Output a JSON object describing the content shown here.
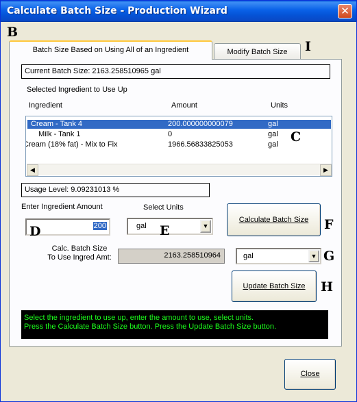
{
  "window": {
    "title": "Calculate Batch Size - Production Wizard",
    "close_glyph": "✕"
  },
  "markers": {
    "b": "B",
    "i": "I",
    "c": "C",
    "d": "D",
    "e": "E",
    "f": "F",
    "g": "G",
    "h": "H"
  },
  "tabs": [
    {
      "label": "Batch Size Based on Using All of an Ingredient"
    },
    {
      "label": "Modify Batch Size"
    }
  ],
  "current_batch_size": "Current Batch Size: 2163.258510965 gal",
  "ingredient_section_label": "Selected Ingredient to Use Up",
  "columns": {
    "ingredient": "Ingredient",
    "amount": "Amount",
    "units": "Units"
  },
  "ingredients": [
    {
      "name": "Cream - Tank 4",
      "amount": "200.000000000079",
      "units": "gal",
      "selected": true
    },
    {
      "name": "Milk - Tank 1",
      "amount": "0",
      "units": "gal",
      "selected": false
    },
    {
      "name": "Cream (18% fat) - Mix to Fix",
      "amount": "1966.56833825053",
      "units": "gal",
      "selected": false
    }
  ],
  "scroll": {
    "left": "◀",
    "right": "▶"
  },
  "usage_level": "Usage Level: 9.09231013 %",
  "enter_amount_label": "Enter Ingredient Amount",
  "select_units_label": "Select Units",
  "amount_input_value": "200",
  "units_select_value": "gal",
  "calc_button_label": "Calculate Batch Size",
  "calc_batch_label_line1": "Calc. Batch Size",
  "calc_batch_label_line2": "To Use Ingred Amt:",
  "calc_batch_value": "2163.258510964",
  "calc_units_value": "gal",
  "update_button_label": "Update Batch Size",
  "status_line1": "Select the ingredient to use up, enter the amount to use, select units.",
  "status_line2": "Press the Calculate Batch Size button. Press the Update Batch Size button.",
  "close_button_label": "Close",
  "dropdown_glyph": "▼"
}
